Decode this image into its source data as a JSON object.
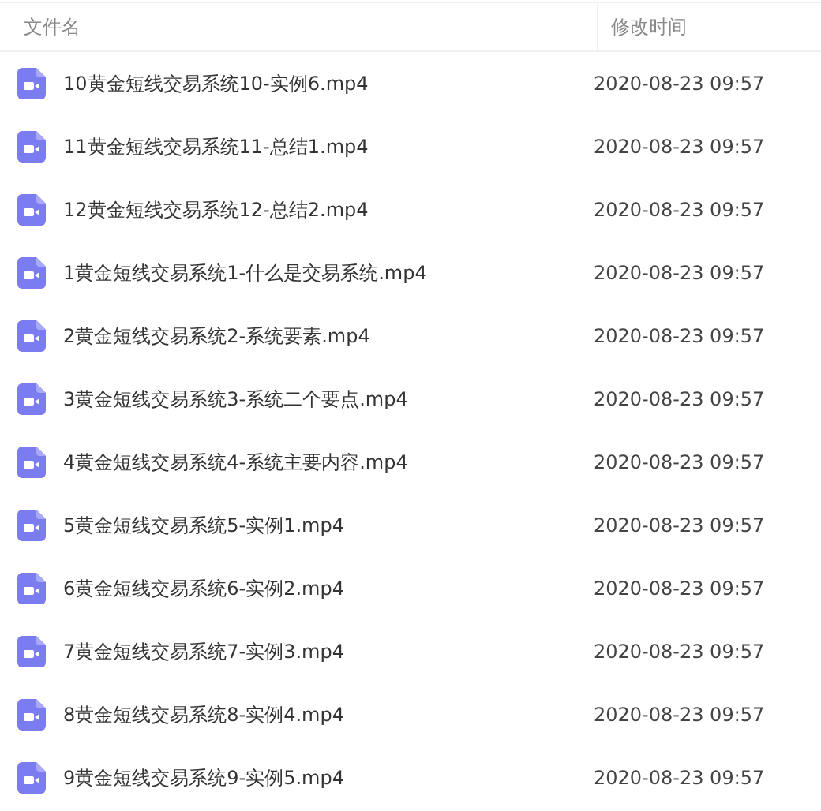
{
  "columns": [
    "文件名",
    "修改时间"
  ],
  "rows": [
    {
      "name": "10黄金短线交易系统10-实例6.mp4",
      "modified": "2020-08-23 09:57"
    },
    {
      "name": "11黄金短线交易系统11-总结1.mp4",
      "modified": "2020-08-23 09:57"
    },
    {
      "name": "12黄金短线交易系统12-总结2.mp4",
      "modified": "2020-08-23 09:57"
    },
    {
      "name": "1黄金短线交易系统1-什么是交易系统.mp4",
      "modified": "2020-08-23 09:57"
    },
    {
      "name": "2黄金短线交易系统2-系统要素.mp4",
      "modified": "2020-08-23 09:57"
    },
    {
      "name": "3黄金短线交易系统3-系统二个要点.mp4",
      "modified": "2020-08-23 09:57"
    },
    {
      "name": "4黄金短线交易系统4-系统主要内容.mp4",
      "modified": "2020-08-23 09:57"
    },
    {
      "name": "5黄金短线交易系统5-实例1.mp4",
      "modified": "2020-08-23 09:57"
    },
    {
      "name": "6黄金短线交易系统6-实例2.mp4",
      "modified": "2020-08-23 09:57"
    },
    {
      "name": "7黄金短线交易系统7-实例3.mp4",
      "modified": "2020-08-23 09:57"
    },
    {
      "name": "8黄金短线交易系统8-实例4.mp4",
      "modified": "2020-08-23 09:57"
    },
    {
      "name": "9黄金短线交易系统9-实例5.mp4",
      "modified": "2020-08-23 09:57"
    }
  ]
}
